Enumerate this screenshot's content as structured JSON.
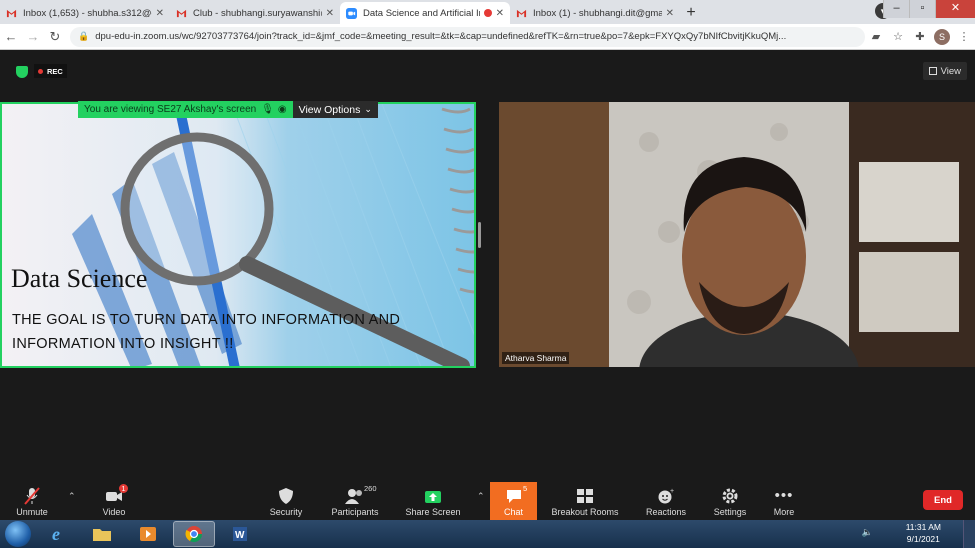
{
  "browser": {
    "tabs": [
      {
        "label": "Inbox (1,653) - shubha.s312@gm",
        "icon": "gmail-icon",
        "active": false
      },
      {
        "label": "Club - shubhangi.suryawanshi@",
        "icon": "gmail-icon",
        "active": false
      },
      {
        "label": "Data Science and Artificial In",
        "icon": "zoom-icon",
        "active": true,
        "recording": true
      },
      {
        "label": "Inbox (1) - shubhangi.dit@gmail",
        "icon": "gmail-icon",
        "active": false
      }
    ],
    "url": "dpu-edu-in.zoom.us/wc/92703773764/join?track_id=&jmf_code=&meeting_result=&tk=&cap=undefined&refTK=&rn=true&po=7&epk=FXYQxQy7bNIfCbvitjKkuQMj...",
    "profile_initial": "S"
  },
  "meeting": {
    "rec_label": "REC",
    "view_label": "View",
    "viewing_banner": "You are viewing SE27 Akshay's screen",
    "view_options_label": "View Options",
    "slide": {
      "title": "Data Science",
      "subtitle": "THE GOAL IS TO TURN DATA INTO INFORMATION AND INFORMATION INTO INSIGHT !!"
    },
    "participant_name": "Atharva Sharma"
  },
  "toolbar": {
    "unmute": "Unmute",
    "video": "Video",
    "video_badge": "1",
    "security": "Security",
    "participants": "Participants",
    "participants_count": "260",
    "share_screen": "Share Screen",
    "chat": "Chat",
    "chat_badge": "5",
    "breakout": "Breakout Rooms",
    "reactions": "Reactions",
    "settings": "Settings",
    "more": "More",
    "end": "End"
  },
  "taskbar": {
    "time": "11:31 AM",
    "date": "9/1/2021"
  },
  "colors": {
    "zoom_green": "#23d160",
    "chat_orange": "#f26d21",
    "end_red": "#e02828"
  }
}
